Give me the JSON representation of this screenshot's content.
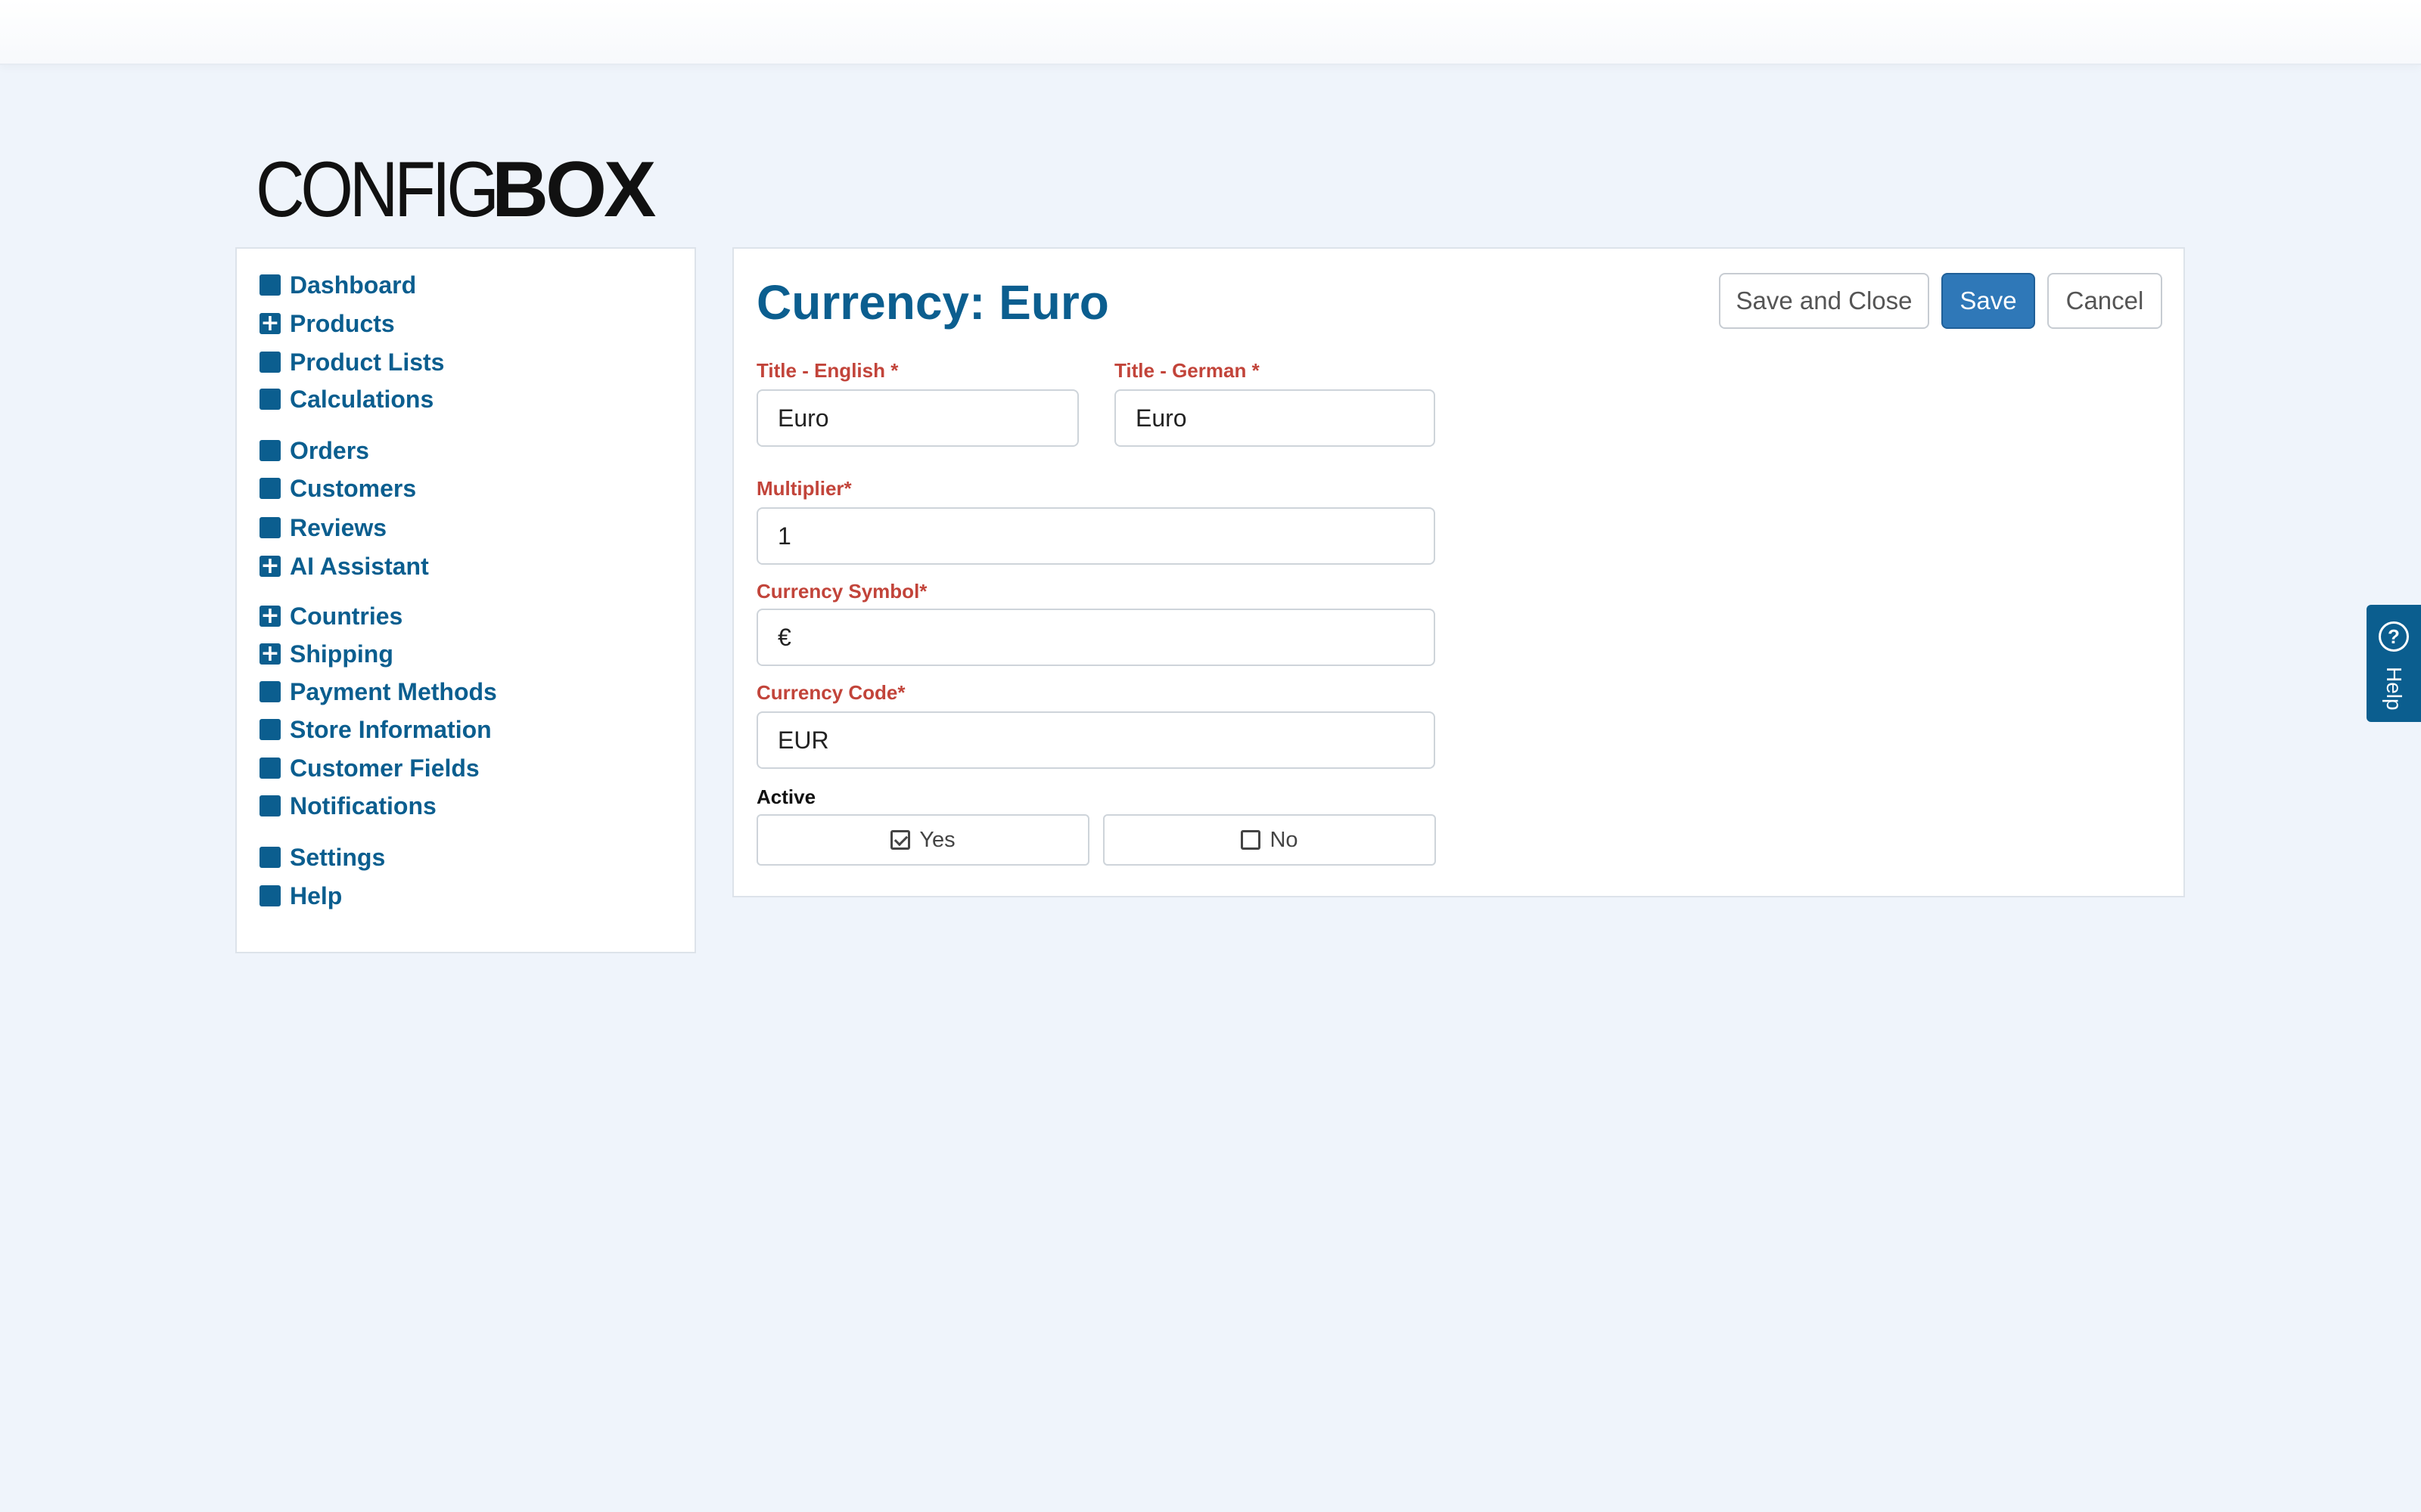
{
  "brand": {
    "logo_light": "CONFIG",
    "logo_bold": "BOX"
  },
  "sidebar": {
    "items": [
      {
        "label": "Dashboard",
        "icon": "square-icon"
      },
      {
        "label": "Products",
        "icon": "plus-square-icon"
      },
      {
        "label": "Product Lists",
        "icon": "square-icon"
      },
      {
        "label": "Calculations",
        "icon": "square-icon"
      },
      {
        "label": "Orders",
        "icon": "square-icon"
      },
      {
        "label": "Customers",
        "icon": "square-icon"
      },
      {
        "label": "Reviews",
        "icon": "square-icon"
      },
      {
        "label": "AI Assistant",
        "icon": "plus-square-icon"
      },
      {
        "label": "Countries",
        "icon": "plus-square-icon"
      },
      {
        "label": "Shipping",
        "icon": "plus-square-icon"
      },
      {
        "label": "Payment Methods",
        "icon": "square-icon"
      },
      {
        "label": "Store Information",
        "icon": "square-icon"
      },
      {
        "label": "Customer Fields",
        "icon": "square-icon"
      },
      {
        "label": "Notifications",
        "icon": "square-icon"
      },
      {
        "label": "Settings",
        "icon": "square-icon"
      },
      {
        "label": "Help",
        "icon": "square-icon"
      }
    ]
  },
  "main": {
    "title": "Currency: Euro",
    "buttons": {
      "save_close": "Save and Close",
      "save": "Save",
      "cancel": "Cancel"
    },
    "fields": {
      "title_en": {
        "label": "Title - English *",
        "value": "Euro"
      },
      "title_de": {
        "label": "Title - German *",
        "value": "Euro"
      },
      "multiplier": {
        "label": "Multiplier*",
        "value": "1"
      },
      "symbol": {
        "label": "Currency Symbol*",
        "value": "€"
      },
      "code": {
        "label": "Currency Code*",
        "value": "EUR"
      }
    },
    "active": {
      "label": "Active",
      "yes": "Yes",
      "no": "No",
      "selected": "Yes"
    }
  },
  "help_tab": {
    "label": "Help"
  },
  "colors": {
    "accent": "#0b5e8f",
    "required": "#c2443a",
    "primary_button": "#2f78b8",
    "background": "#eff4fb"
  }
}
